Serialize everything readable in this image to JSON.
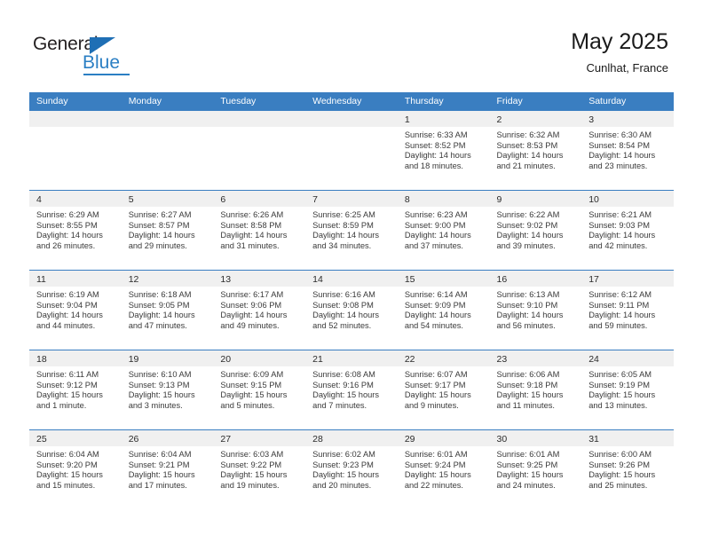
{
  "brand": {
    "name_part1": "General",
    "name_part2": "Blue",
    "accent_color": "#2b7fc4",
    "triangle_color": "#1f6fb5"
  },
  "header": {
    "title": "May 2025",
    "subtitle": "Cunlhat, France"
  },
  "theme": {
    "header_row_color": "#3a7ec1",
    "daynum_band_color": "#f0f0f0",
    "text_color": "#3a3a3a"
  },
  "calendar": {
    "day_names": [
      "Sunday",
      "Monday",
      "Tuesday",
      "Wednesday",
      "Thursday",
      "Friday",
      "Saturday"
    ],
    "weeks": [
      [
        {
          "day": "",
          "lines": []
        },
        {
          "day": "",
          "lines": []
        },
        {
          "day": "",
          "lines": []
        },
        {
          "day": "",
          "lines": []
        },
        {
          "day": "1",
          "lines": [
            "Sunrise: 6:33 AM",
            "Sunset: 8:52 PM",
            "Daylight: 14 hours",
            "and 18 minutes."
          ]
        },
        {
          "day": "2",
          "lines": [
            "Sunrise: 6:32 AM",
            "Sunset: 8:53 PM",
            "Daylight: 14 hours",
            "and 21 minutes."
          ]
        },
        {
          "day": "3",
          "lines": [
            "Sunrise: 6:30 AM",
            "Sunset: 8:54 PM",
            "Daylight: 14 hours",
            "and 23 minutes."
          ]
        }
      ],
      [
        {
          "day": "4",
          "lines": [
            "Sunrise: 6:29 AM",
            "Sunset: 8:55 PM",
            "Daylight: 14 hours",
            "and 26 minutes."
          ]
        },
        {
          "day": "5",
          "lines": [
            "Sunrise: 6:27 AM",
            "Sunset: 8:57 PM",
            "Daylight: 14 hours",
            "and 29 minutes."
          ]
        },
        {
          "day": "6",
          "lines": [
            "Sunrise: 6:26 AM",
            "Sunset: 8:58 PM",
            "Daylight: 14 hours",
            "and 31 minutes."
          ]
        },
        {
          "day": "7",
          "lines": [
            "Sunrise: 6:25 AM",
            "Sunset: 8:59 PM",
            "Daylight: 14 hours",
            "and 34 minutes."
          ]
        },
        {
          "day": "8",
          "lines": [
            "Sunrise: 6:23 AM",
            "Sunset: 9:00 PM",
            "Daylight: 14 hours",
            "and 37 minutes."
          ]
        },
        {
          "day": "9",
          "lines": [
            "Sunrise: 6:22 AM",
            "Sunset: 9:02 PM",
            "Daylight: 14 hours",
            "and 39 minutes."
          ]
        },
        {
          "day": "10",
          "lines": [
            "Sunrise: 6:21 AM",
            "Sunset: 9:03 PM",
            "Daylight: 14 hours",
            "and 42 minutes."
          ]
        }
      ],
      [
        {
          "day": "11",
          "lines": [
            "Sunrise: 6:19 AM",
            "Sunset: 9:04 PM",
            "Daylight: 14 hours",
            "and 44 minutes."
          ]
        },
        {
          "day": "12",
          "lines": [
            "Sunrise: 6:18 AM",
            "Sunset: 9:05 PM",
            "Daylight: 14 hours",
            "and 47 minutes."
          ]
        },
        {
          "day": "13",
          "lines": [
            "Sunrise: 6:17 AM",
            "Sunset: 9:06 PM",
            "Daylight: 14 hours",
            "and 49 minutes."
          ]
        },
        {
          "day": "14",
          "lines": [
            "Sunrise: 6:16 AM",
            "Sunset: 9:08 PM",
            "Daylight: 14 hours",
            "and 52 minutes."
          ]
        },
        {
          "day": "15",
          "lines": [
            "Sunrise: 6:14 AM",
            "Sunset: 9:09 PM",
            "Daylight: 14 hours",
            "and 54 minutes."
          ]
        },
        {
          "day": "16",
          "lines": [
            "Sunrise: 6:13 AM",
            "Sunset: 9:10 PM",
            "Daylight: 14 hours",
            "and 56 minutes."
          ]
        },
        {
          "day": "17",
          "lines": [
            "Sunrise: 6:12 AM",
            "Sunset: 9:11 PM",
            "Daylight: 14 hours",
            "and 59 minutes."
          ]
        }
      ],
      [
        {
          "day": "18",
          "lines": [
            "Sunrise: 6:11 AM",
            "Sunset: 9:12 PM",
            "Daylight: 15 hours",
            "and 1 minute."
          ]
        },
        {
          "day": "19",
          "lines": [
            "Sunrise: 6:10 AM",
            "Sunset: 9:13 PM",
            "Daylight: 15 hours",
            "and 3 minutes."
          ]
        },
        {
          "day": "20",
          "lines": [
            "Sunrise: 6:09 AM",
            "Sunset: 9:15 PM",
            "Daylight: 15 hours",
            "and 5 minutes."
          ]
        },
        {
          "day": "21",
          "lines": [
            "Sunrise: 6:08 AM",
            "Sunset: 9:16 PM",
            "Daylight: 15 hours",
            "and 7 minutes."
          ]
        },
        {
          "day": "22",
          "lines": [
            "Sunrise: 6:07 AM",
            "Sunset: 9:17 PM",
            "Daylight: 15 hours",
            "and 9 minutes."
          ]
        },
        {
          "day": "23",
          "lines": [
            "Sunrise: 6:06 AM",
            "Sunset: 9:18 PM",
            "Daylight: 15 hours",
            "and 11 minutes."
          ]
        },
        {
          "day": "24",
          "lines": [
            "Sunrise: 6:05 AM",
            "Sunset: 9:19 PM",
            "Daylight: 15 hours",
            "and 13 minutes."
          ]
        }
      ],
      [
        {
          "day": "25",
          "lines": [
            "Sunrise: 6:04 AM",
            "Sunset: 9:20 PM",
            "Daylight: 15 hours",
            "and 15 minutes."
          ]
        },
        {
          "day": "26",
          "lines": [
            "Sunrise: 6:04 AM",
            "Sunset: 9:21 PM",
            "Daylight: 15 hours",
            "and 17 minutes."
          ]
        },
        {
          "day": "27",
          "lines": [
            "Sunrise: 6:03 AM",
            "Sunset: 9:22 PM",
            "Daylight: 15 hours",
            "and 19 minutes."
          ]
        },
        {
          "day": "28",
          "lines": [
            "Sunrise: 6:02 AM",
            "Sunset: 9:23 PM",
            "Daylight: 15 hours",
            "and 20 minutes."
          ]
        },
        {
          "day": "29",
          "lines": [
            "Sunrise: 6:01 AM",
            "Sunset: 9:24 PM",
            "Daylight: 15 hours",
            "and 22 minutes."
          ]
        },
        {
          "day": "30",
          "lines": [
            "Sunrise: 6:01 AM",
            "Sunset: 9:25 PM",
            "Daylight: 15 hours",
            "and 24 minutes."
          ]
        },
        {
          "day": "31",
          "lines": [
            "Sunrise: 6:00 AM",
            "Sunset: 9:26 PM",
            "Daylight: 15 hours",
            "and 25 minutes."
          ]
        }
      ]
    ]
  }
}
